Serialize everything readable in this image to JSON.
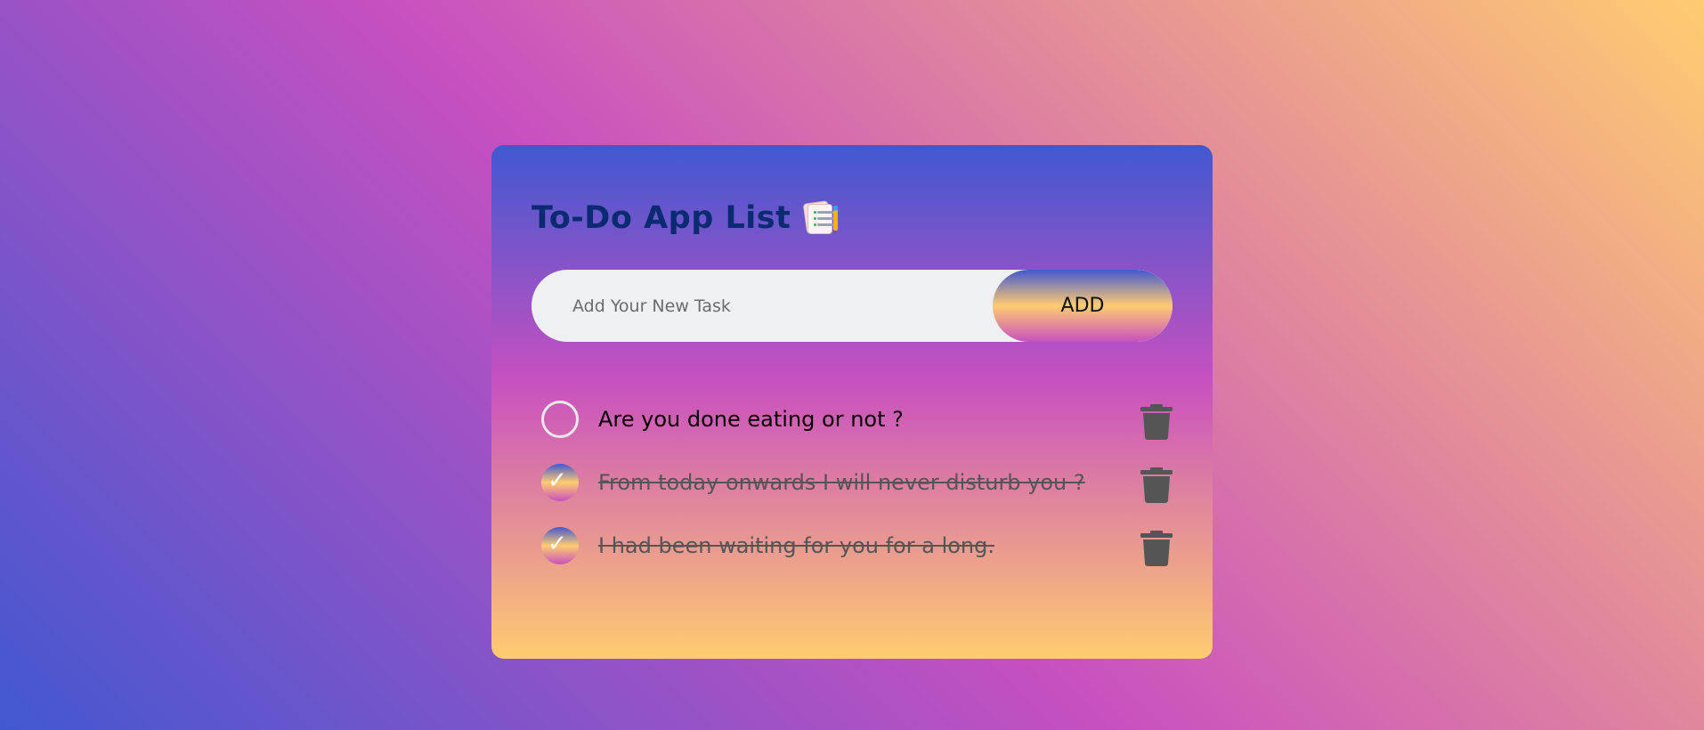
{
  "app": {
    "title": "To-Do App List"
  },
  "input": {
    "placeholder": "Add Your New Task",
    "value": ""
  },
  "add_button": {
    "label": "ADD"
  },
  "tasks": [
    {
      "text": "Are you done eating or not ?",
      "done": false,
      "check_icon": "empty-circle-icon",
      "delete_icon": "trash-icon"
    },
    {
      "text": "From today onwards I will never disturb you ?",
      "done": true,
      "check_icon": "checked-circle-icon",
      "delete_icon": "trash-icon"
    },
    {
      "text": "I had been waiting for you for a long.",
      "done": true,
      "check_icon": "checked-circle-icon",
      "delete_icon": "trash-icon"
    }
  ],
  "colors": {
    "gradient_start": "#4158d0",
    "gradient_mid": "#c850c0",
    "gradient_end": "#ffcc70",
    "title": "#0a2a72",
    "input_bg": "#eff0f1",
    "trash": "#555555"
  }
}
